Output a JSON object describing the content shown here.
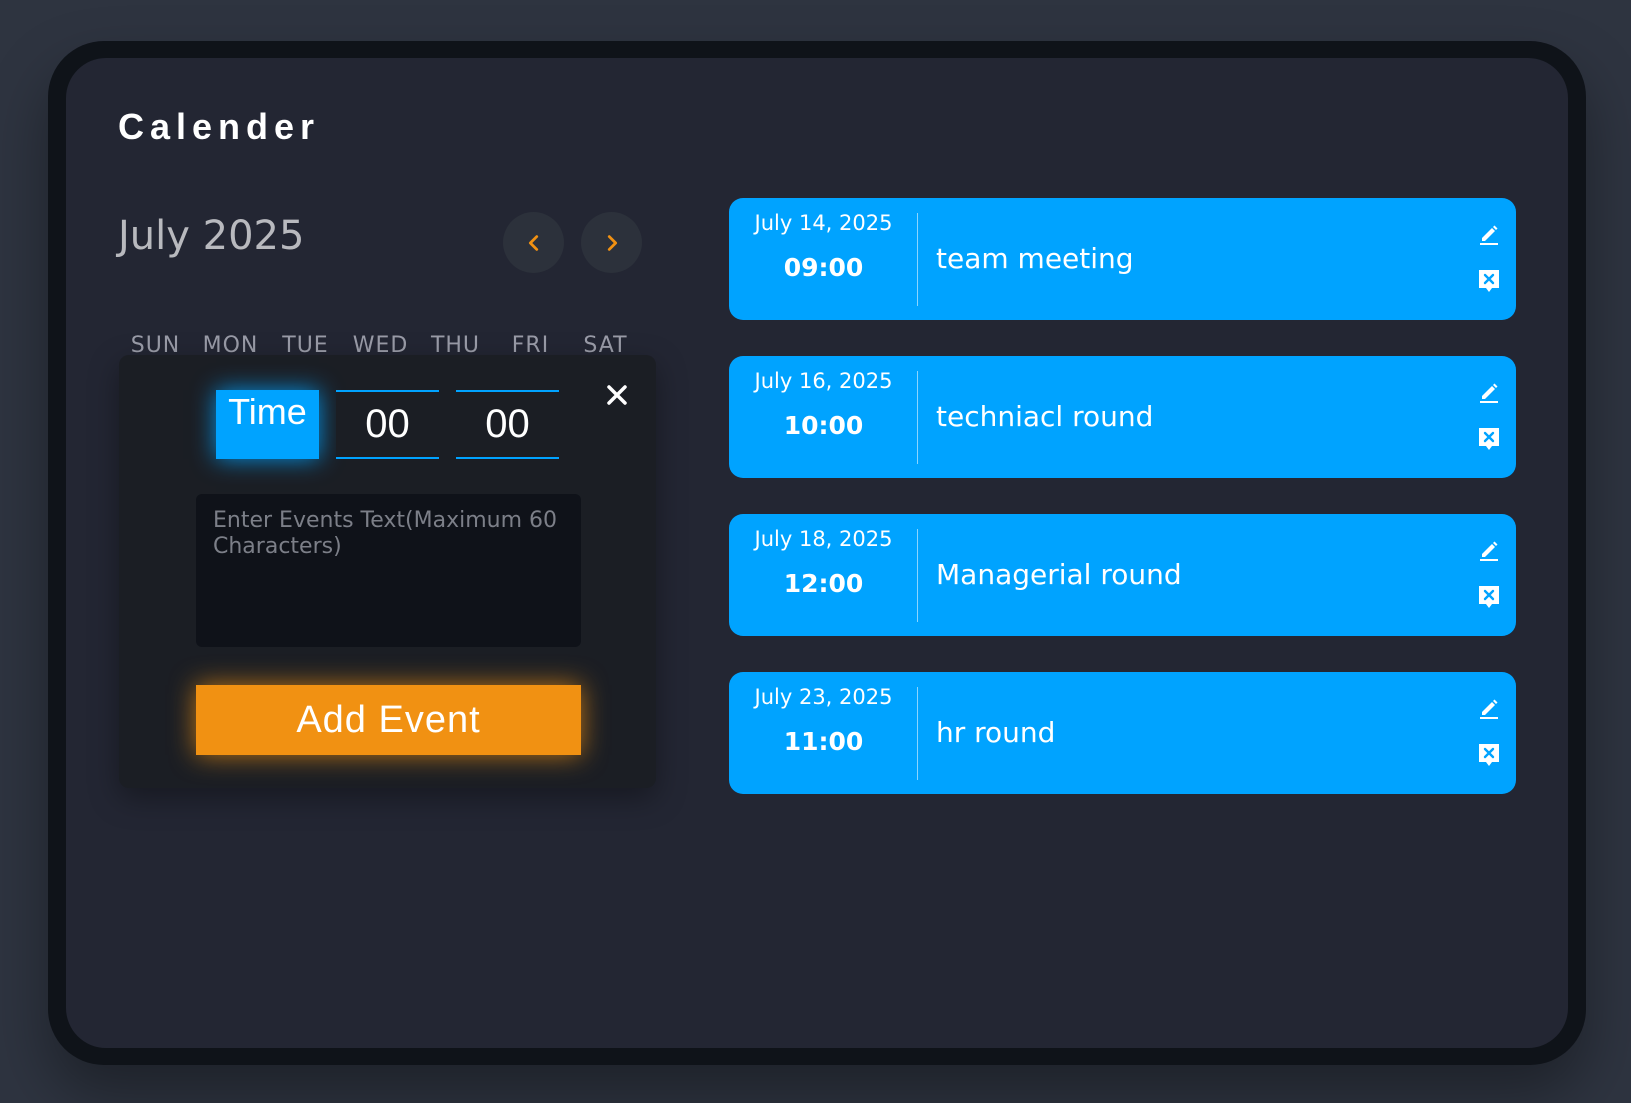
{
  "header": {
    "title": "Calender"
  },
  "calendar": {
    "month_label": "July 2025",
    "prev_icon": "chevron-left-icon",
    "next_icon": "chevron-right-icon",
    "weekdays": [
      "SUN",
      "MON",
      "TUE",
      "WED",
      "THU",
      "FRI",
      "SAT"
    ]
  },
  "popup": {
    "time_label": "Time",
    "hours_value": "00",
    "minutes_value": "00",
    "close_icon": "close-icon",
    "event_placeholder": "Enter Events Text(Maximum 60 Characters)",
    "add_button_label": "Add Event"
  },
  "events": [
    {
      "date": "July 14, 2025",
      "time": "09:00",
      "text": "team meeting"
    },
    {
      "date": "July 16, 2025",
      "time": "10:00",
      "text": "techniacl round"
    },
    {
      "date": "July 18, 2025",
      "time": "12:00",
      "text": "Managerial round"
    },
    {
      "date": "July 23, 2025",
      "time": "11:00",
      "text": "hr round"
    }
  ],
  "colors": {
    "background": "#2e3440",
    "panel": "#232633",
    "accent_blue": "#00a3ff",
    "accent_orange": "#f19112"
  }
}
